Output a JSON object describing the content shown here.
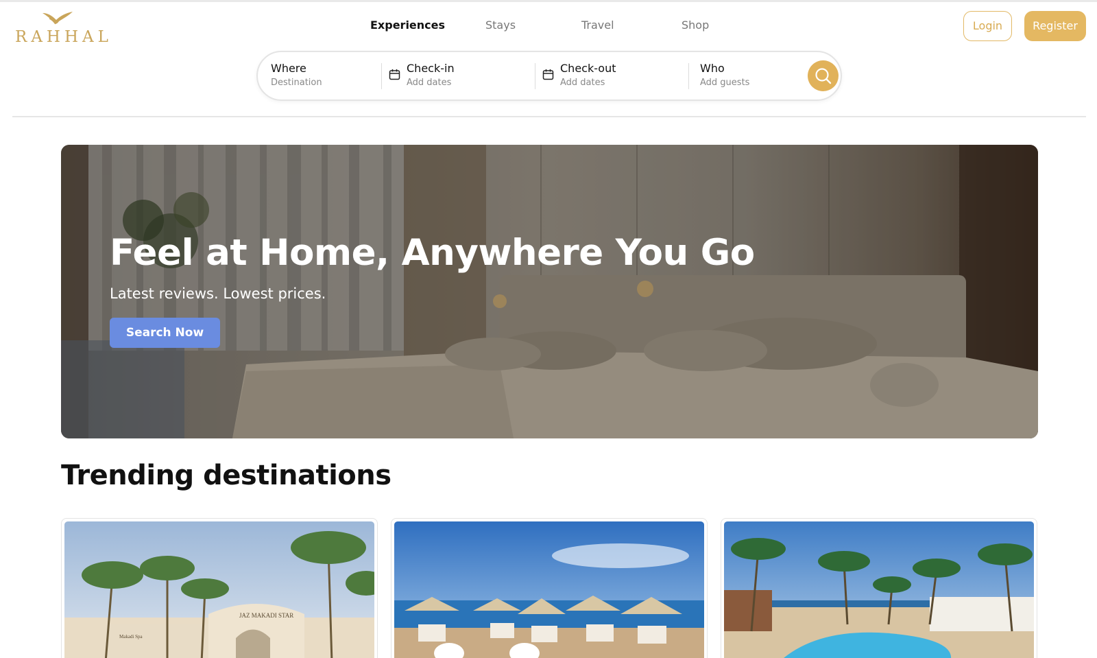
{
  "brand": {
    "name": "RAHHAL",
    "accent": "#e1b25a"
  },
  "nav": {
    "items": [
      "Experiences",
      "Stays",
      "Travel",
      "Shop"
    ],
    "active": "Experiences"
  },
  "auth": {
    "login_label": "Login",
    "register_label": "Register"
  },
  "search": {
    "where": {
      "label": "Where",
      "placeholder": "Destination"
    },
    "checkin": {
      "label": "Check-in",
      "placeholder": "Add dates"
    },
    "checkout": {
      "label": "Check-out",
      "placeholder": "Add dates"
    },
    "who": {
      "label": "Who",
      "placeholder": "Add guests"
    },
    "button_icon": "search-icon"
  },
  "hero": {
    "title": "Feel at Home, Anywhere You Go",
    "subtitle": "Latest reviews. Lowest prices.",
    "button_label": "Search Now",
    "button_color": "#6a8ce0"
  },
  "trending": {
    "title": "Trending destinations",
    "cards": [
      {
        "image": "resort-entrance-palms",
        "sign": "JAZ MAKADI STAR",
        "plaque": "Makadi Spa"
      },
      {
        "image": "beach-umbrellas-sea"
      },
      {
        "image": "pool-palms-resort"
      }
    ]
  }
}
